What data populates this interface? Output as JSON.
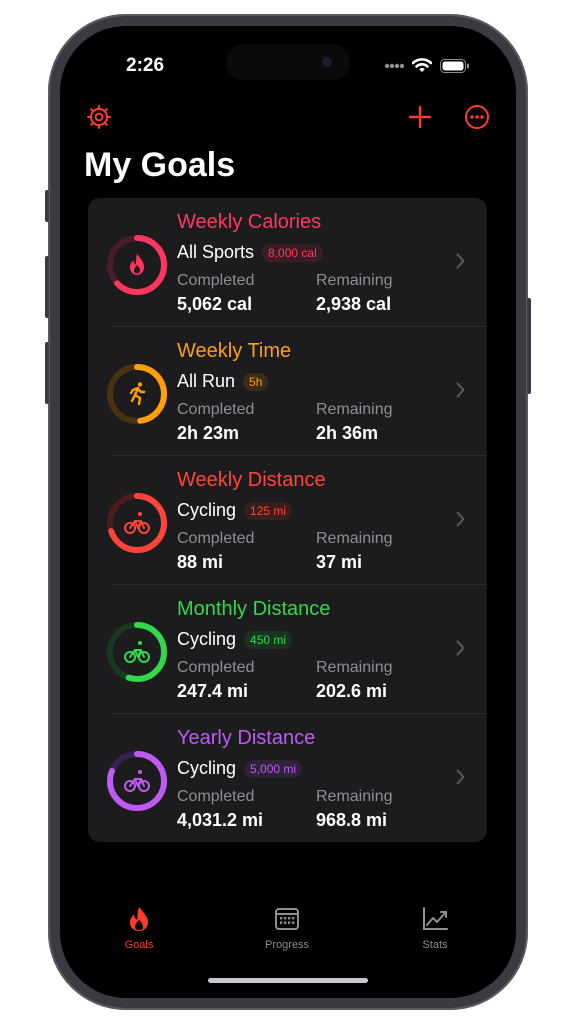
{
  "status_bar": {
    "time": "2:26"
  },
  "colors": {
    "accent": "#ff3b30",
    "calories": "#ff375f",
    "time": "#ff9f0a",
    "distance": "#ff453a",
    "monthly": "#32d74b",
    "yearly": "#bf5af2"
  },
  "header": {
    "settings_icon": "gear-icon",
    "add_icon": "plus-icon",
    "more_icon": "ellipsis-circle-icon",
    "title": "My Goals"
  },
  "goals": [
    {
      "title": "Weekly Calories",
      "sport": "All Sports",
      "target": "8,000 cal",
      "completed_label": "Completed",
      "completed": "5,062 cal",
      "remaining_label": "Remaining",
      "remaining": "2,938 cal",
      "progress": 0.63,
      "icon": "flame-icon"
    },
    {
      "title": "Weekly Time",
      "sport": "All Run",
      "target": "5h",
      "completed_label": "Completed",
      "completed": "2h 23m",
      "remaining_label": "Remaining",
      "remaining": "2h 36m",
      "progress": 0.48,
      "icon": "runner-icon"
    },
    {
      "title": "Weekly Distance",
      "sport": "Cycling",
      "target": "125 mi",
      "completed_label": "Completed",
      "completed": "88 mi",
      "remaining_label": "Remaining",
      "remaining": "37 mi",
      "progress": 0.7,
      "icon": "bicycle-icon"
    },
    {
      "title": "Monthly Distance",
      "sport": "Cycling",
      "target": "450 mi",
      "completed_label": "Completed",
      "completed": "247.4 mi",
      "remaining_label": "Remaining",
      "remaining": "202.6 mi",
      "progress": 0.55,
      "icon": "bicycle-icon"
    },
    {
      "title": "Yearly Distance",
      "sport": "Cycling",
      "target": "5,000 mi",
      "completed_label": "Completed",
      "completed": "4,031.2 mi",
      "remaining_label": "Remaining",
      "remaining": "968.8 mi",
      "progress": 0.81,
      "icon": "bicycle-icon"
    }
  ],
  "tabbar": {
    "tabs": [
      {
        "label": "Goals",
        "icon": "flame-icon",
        "active": true
      },
      {
        "label": "Progress",
        "icon": "calendar-icon",
        "active": false
      },
      {
        "label": "Stats",
        "icon": "chart-icon",
        "active": false
      }
    ]
  }
}
